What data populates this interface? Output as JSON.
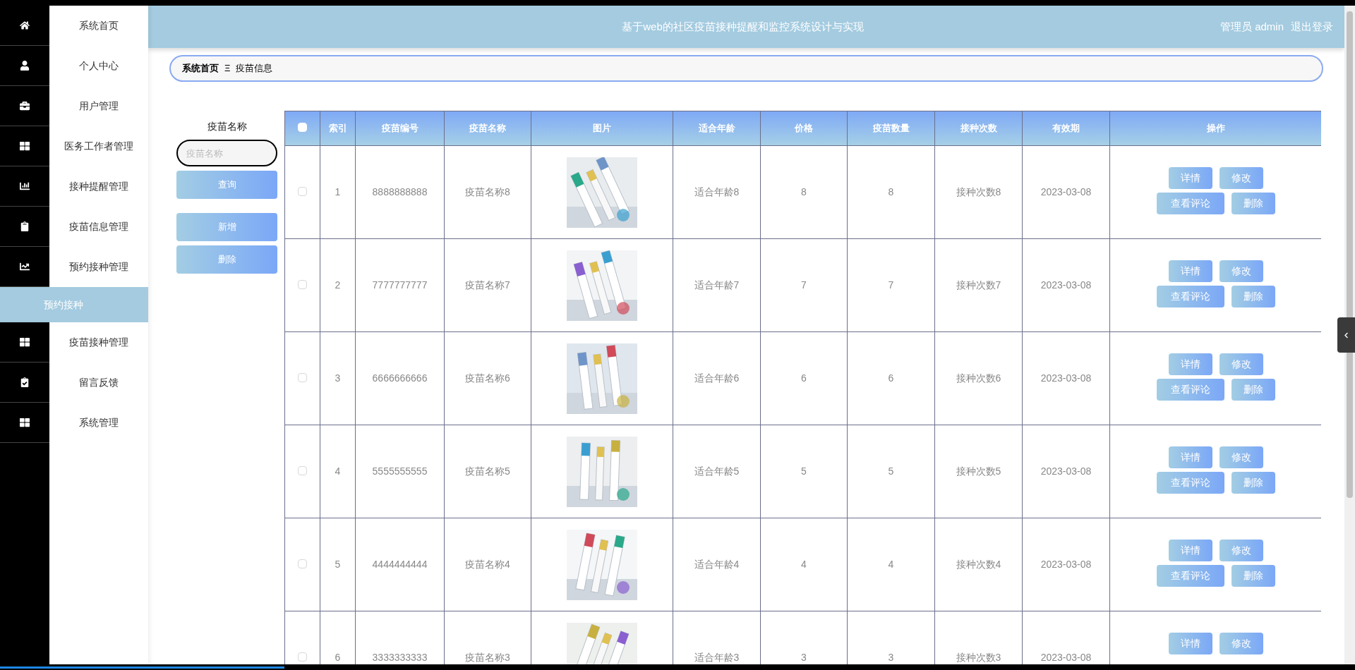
{
  "header": {
    "title": "基于web的社区疫苗接种提醒和监控系统设计与实现",
    "user": "管理员 admin",
    "logout": "退出登录"
  },
  "sidebar": {
    "items": [
      {
        "label": "系统首页",
        "selected": false
      },
      {
        "label": "个人中心",
        "selected": false
      },
      {
        "label": "用户管理",
        "selected": false
      },
      {
        "label": "医务工作者管理",
        "selected": false
      },
      {
        "label": "接种提醒管理",
        "selected": false
      },
      {
        "label": "疫苗信息管理",
        "selected": false
      },
      {
        "label": "预约接种管理",
        "selected": false,
        "expanded": true,
        "children": [
          {
            "label": "预约接种",
            "selected": true
          }
        ]
      },
      {
        "label": "疫苗接种管理",
        "selected": false
      },
      {
        "label": "留言反馈",
        "selected": false
      },
      {
        "label": "系统管理",
        "selected": false
      }
    ]
  },
  "breadcrumb": [
    "系统首页",
    "Ξ",
    "疫苗信息"
  ],
  "search": {
    "label": "疫苗名称",
    "placeholder": "疫苗名称",
    "buttons": [
      "查询",
      "新增",
      "删除"
    ]
  },
  "table": {
    "select_all": {
      "checked": false
    },
    "columns": [
      "索引",
      "疫苗编号",
      "疫苗名称",
      "图片",
      "适合年龄",
      "价格",
      "疫苗数量",
      "接种次数",
      "有效期",
      "操作"
    ],
    "rows": [
      {
        "checked": false,
        "cells": [
          "1",
          "8888888888",
          "疫苗名称8",
          {
            "kind": "picture"
          },
          "适合年龄8",
          "8",
          "8",
          "接种次数8",
          "2023-03-08"
        ],
        "actions": [
          "详情",
          "修改",
          "查看评论",
          "删除"
        ]
      },
      {
        "checked": false,
        "cells": [
          "2",
          "7777777777",
          "疫苗名称7",
          {
            "kind": "picture"
          },
          "适合年龄7",
          "7",
          "7",
          "接种次数7",
          "2023-03-08"
        ],
        "actions": [
          "详情",
          "修改",
          "查看评论",
          "删除"
        ]
      },
      {
        "checked": false,
        "cells": [
          "3",
          "6666666666",
          "疫苗名称6",
          {
            "kind": "picture"
          },
          "适合年龄6",
          "6",
          "6",
          "接种次数6",
          "2023-03-08"
        ],
        "actions": [
          "详情",
          "修改",
          "查看评论",
          "删除"
        ]
      },
      {
        "checked": false,
        "cells": [
          "4",
          "5555555555",
          "疫苗名称5",
          {
            "kind": "picture"
          },
          "适合年龄5",
          "5",
          "5",
          "接种次数5",
          "2023-03-08"
        ],
        "actions": [
          "详情",
          "修改",
          "查看评论",
          "删除"
        ]
      },
      {
        "checked": false,
        "cells": [
          "5",
          "4444444444",
          "疫苗名称4",
          {
            "kind": "picture"
          },
          "适合年龄4",
          "4",
          "4",
          "接种次数4",
          "2023-03-08"
        ],
        "actions": [
          "详情",
          "修改",
          "查看评论",
          "删除"
        ]
      },
      {
        "checked": false,
        "cells": [
          "6",
          "3333333333",
          "疫苗名称3",
          {
            "kind": "picture"
          },
          "适合年龄3",
          "3",
          "3",
          "接种次数3",
          "2023-03-08"
        ],
        "actions": [
          "详情",
          "修改"
        ]
      }
    ]
  },
  "playback": {
    "level": 0.21
  }
}
